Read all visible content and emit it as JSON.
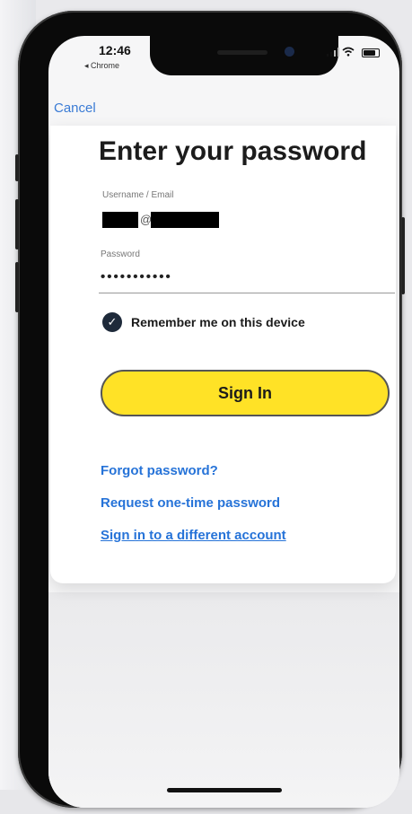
{
  "status_bar": {
    "time": "12:46",
    "back_app": "◂ Chrome"
  },
  "nav": {
    "cancel_label": "Cancel"
  },
  "form": {
    "title": "Enter your password",
    "username_label": "Username / Email",
    "username_at": "@",
    "password_label": "Password",
    "password_mask": "•••••••••••",
    "remember_checked": true,
    "remember_label": "Remember me on this device",
    "signin_label": "Sign In"
  },
  "links": {
    "forgot": "Forgot password?",
    "one_time": "Request one-time password",
    "different_account": "Sign in to a different account"
  },
  "colors": {
    "accent_link": "#2673d8",
    "button_yellow": "#ffe226",
    "check_fill": "#1e2a3a"
  },
  "icons": [
    "signal-icon",
    "wifi-icon",
    "battery-icon",
    "check-circle-icon"
  ]
}
